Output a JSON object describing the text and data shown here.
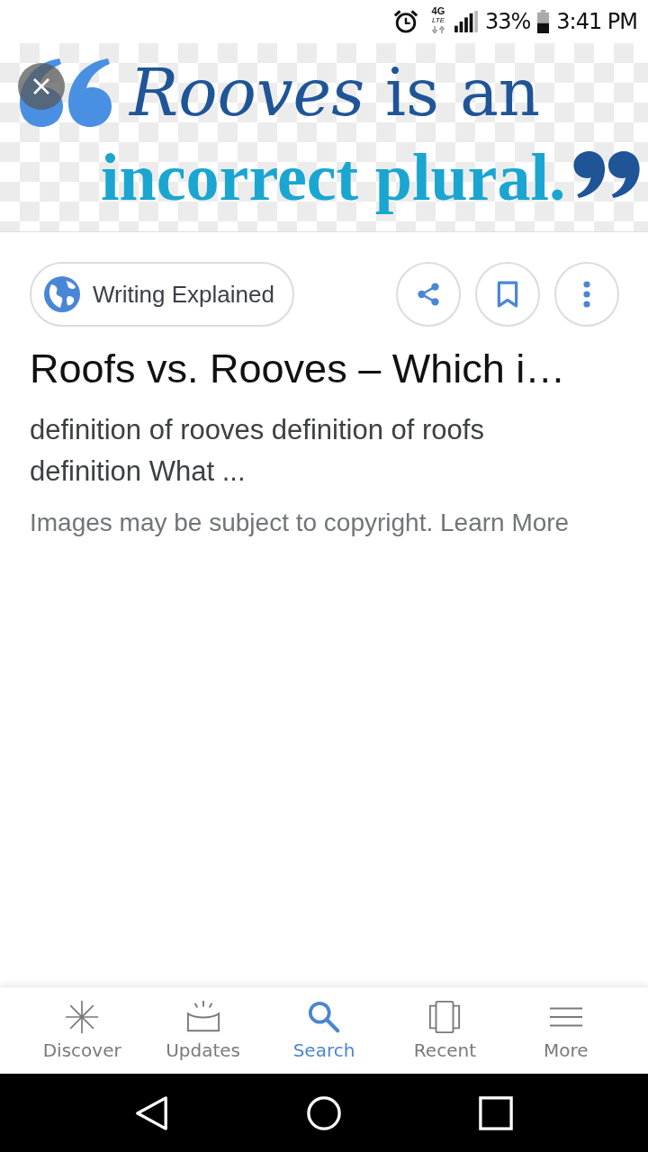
{
  "status_bar": {
    "network": "4G",
    "network_sub": "LTE",
    "battery": "33%",
    "time": "3:41 PM"
  },
  "image": {
    "line_1": "*Rooves* is an",
    "line_2": "incorrect plural."
  },
  "result": {
    "source": "Writing Explained",
    "title": "Roofs vs. Rooves – Which i…",
    "description": "definition of rooves definition of roofs definition What ...",
    "notice": "Images may be subject to copyright.",
    "notice_link": "Learn More"
  },
  "bottom_nav": [
    {
      "label": "Discover",
      "selected": false
    },
    {
      "label": "Updates",
      "selected": false
    },
    {
      "label": "Search",
      "selected": true
    },
    {
      "label": "Recent",
      "selected": false
    },
    {
      "label": "More",
      "selected": false
    }
  ]
}
